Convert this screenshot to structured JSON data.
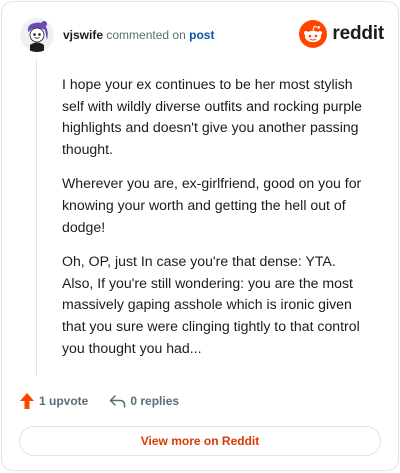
{
  "header": {
    "username": "vjswife",
    "commented_text": "commented on",
    "post_link": "post",
    "brand_wordmark": "reddit"
  },
  "comment": {
    "paragraphs": [
      "I hope your ex continues to be her most stylish self with wildly diverse outfits and rocking purple highlights and doesn't give you another passing thought.",
      "Wherever you are, ex-girlfriend, good on you for knowing your worth and getting the hell out of dodge!",
      "Oh, OP, just In case you're that dense: YTA. Also, If you're still wondering: you are the most massively gaping asshole which is ironic given that you sure were clinging tightly to that control you thought you had..."
    ]
  },
  "footer": {
    "upvote_label": "1 upvote",
    "replies_label": "0 replies"
  },
  "view_more_label": "View more on Reddit",
  "icons": {
    "avatar": "snoo-avatar",
    "brand": "reddit-logo-icon",
    "upvote": "upvote-arrow-icon",
    "reply": "reply-arrow-icon"
  },
  "colors": {
    "brand_orange": "#ff4500",
    "upvote_active": "#ff4500",
    "link_blue": "#0a57a0",
    "view_more_text": "#d93a00",
    "muted_text": "#576f76",
    "border": "#e1e3e5"
  }
}
